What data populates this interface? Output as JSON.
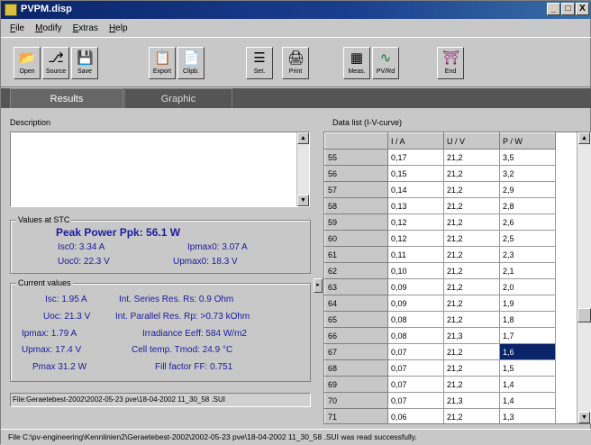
{
  "window": {
    "title": "PVPM.disp"
  },
  "window_buttons": {
    "minimize": "_",
    "maximize": "□",
    "close": "X"
  },
  "menu": [
    "File",
    "Modify",
    "Extras",
    "Help"
  ],
  "toolbar": [
    {
      "label": "Open",
      "icon": "folder-icon",
      "glyph": "📂"
    },
    {
      "label": "Source",
      "icon": "source-icon",
      "glyph": "⎇"
    },
    {
      "label": "Save",
      "icon": "save-icon",
      "glyph": "💾"
    },
    {
      "label": "Export",
      "icon": "export-icon",
      "glyph": "📋"
    },
    {
      "label": "Clipb.",
      "icon": "clipboard-icon",
      "glyph": "📄"
    },
    {
      "label": "Set.",
      "icon": "settings-icon",
      "glyph": "☰"
    },
    {
      "label": "Print",
      "icon": "printer-icon",
      "glyph": "🖨"
    },
    {
      "label": "Meas.",
      "icon": "measure-icon",
      "glyph": "▦"
    },
    {
      "label": "PV/Rd",
      "icon": "pv-icon",
      "glyph": "∿"
    },
    {
      "label": "End",
      "icon": "exit-icon",
      "glyph": "⛩"
    }
  ],
  "tabs": {
    "results": "Results",
    "graphic": "Graphic"
  },
  "description": {
    "label": "Description",
    "text": ""
  },
  "stc": {
    "title": "Values at STC",
    "peak_power": "Peak Power Ppk: 56.1 W",
    "isc0": "Isc0: 3.34 A",
    "ipmax0": "Ipmax0: 3.07 A",
    "uoc0": "Uoc0: 22.3 V",
    "upmax0": "Upmax0: 18.3 V"
  },
  "current": {
    "title": "Current values",
    "isc": "Isc: 1.95 A",
    "uoc": "Uoc: 21.3 V",
    "ipmax": "Ipmax: 1.79 A",
    "upmax": "Upmax: 17.4 V",
    "pmax": "Pmax 31.2 W",
    "rs": "Int. Series Res. Rs: 0.9 Ohm",
    "rp": "Int. Parallel Res. Rp: >0.73 kOhm",
    "eeff": "Irradiance Eeff: 584 W/m2",
    "tmod": "Cell temp. Tmod: 24.9 °C",
    "ff": "Fill factor FF: 0.751"
  },
  "file_line": "File:Geraetebest-2002\\2002-05-23 pve\\18-04-2002  11_30_58 .SUI",
  "datalist": {
    "label": "Data list (I-V-curve)",
    "headers": [
      "",
      "I / A",
      "U / V",
      "P / W"
    ],
    "rows": [
      [
        "55",
        "0,17",
        "21,2",
        "3,5"
      ],
      [
        "56",
        "0,15",
        "21,2",
        "3,2"
      ],
      [
        "57",
        "0,14",
        "21,2",
        "2,9"
      ],
      [
        "58",
        "0,13",
        "21,2",
        "2,8"
      ],
      [
        "59",
        "0,12",
        "21,2",
        "2,6"
      ],
      [
        "60",
        "0,12",
        "21,2",
        "2,5"
      ],
      [
        "61",
        "0,11",
        "21,2",
        "2,3"
      ],
      [
        "62",
        "0,10",
        "21,2",
        "2,1"
      ],
      [
        "63",
        "0,09",
        "21,2",
        "2,0"
      ],
      [
        "64",
        "0,09",
        "21,2",
        "1,9"
      ],
      [
        "65",
        "0,08",
        "21,2",
        "1,8"
      ],
      [
        "66",
        "0,08",
        "21,3",
        "1,7"
      ],
      [
        "67",
        "0,07",
        "21,2",
        "1,6"
      ],
      [
        "68",
        "0,07",
        "21,2",
        "1,5"
      ],
      [
        "69",
        "0,07",
        "21,2",
        "1,4"
      ],
      [
        "70",
        "0,07",
        "21,3",
        "1,4"
      ],
      [
        "71",
        "0,06",
        "21,2",
        "1,3"
      ]
    ],
    "selected_row": 12
  },
  "status": "File C:\\pv-engineering\\Kennlinien2\\Geraetebest-2002\\2002-05-23 pve\\18-04-2002  11_30_58 .SUI was read successfully."
}
